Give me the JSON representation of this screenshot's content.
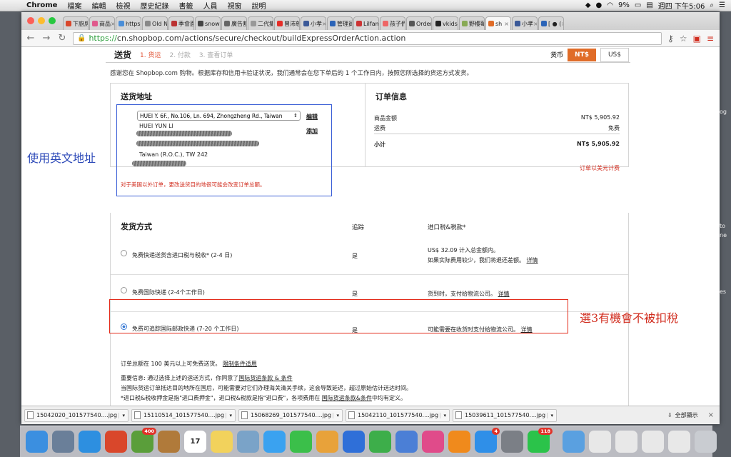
{
  "menubar": {
    "app": "Chrome",
    "items": [
      "檔案",
      "編輯",
      "檢視",
      "歷史紀錄",
      "書籤",
      "人員",
      "視窗",
      "說明"
    ],
    "battery": "9%",
    "clock": "週四 下午5:06"
  },
  "tabs": [
    {
      "title": "下廚房",
      "color": "#d9472b"
    },
    {
      "title": "商品",
      "color": "#e05a8c"
    },
    {
      "title": "https",
      "color": "#4a8ed8"
    },
    {
      "title": "Old N",
      "color": "#888"
    },
    {
      "title": "季會面",
      "color": "#b33"
    },
    {
      "title": "snow",
      "color": "#444"
    },
    {
      "title": "廣告割",
      "color": "#666"
    },
    {
      "title": "二代集",
      "color": "#999"
    },
    {
      "title": "曾沛慈",
      "color": "#e52d27"
    },
    {
      "title": "小孝",
      "color": "#3b5998"
    },
    {
      "title": "管理員",
      "color": "#2b64b8"
    },
    {
      "title": "Lilfam",
      "color": "#c33"
    },
    {
      "title": "孩子們",
      "color": "#e66"
    },
    {
      "title": "Order",
      "color": "#555"
    },
    {
      "title": "vkids",
      "color": "#222"
    },
    {
      "title": "野櫻莓",
      "color": "#8a5"
    },
    {
      "title": "sh",
      "color": "#e06c28",
      "active": true
    },
    {
      "title": "小孝",
      "color": "#3b5998"
    },
    {
      "title": "[ ● (",
      "color": "#2b64b8"
    }
  ],
  "url": {
    "scheme": "https://",
    "rest": "cn.shopbop.com/actions/secure/checkout/buildExpressOrderAction.action"
  },
  "checkout": {
    "title": "送货",
    "steps": [
      "1. 货运",
      "2. 付款",
      "3. 查看订单"
    ],
    "currency_label": "货币",
    "currency_selected": "NT$",
    "currency_other": "US$",
    "intro": "感谢您在 Shopbop.com 购物。根据库存和信用卡验证状况，我们通常会在您下单后的 1 个工作日内，按照您所选择的货运方式发货。",
    "address": {
      "heading": "送货地址",
      "selected": "HUEI Y. 6F., No.106, Ln. 694, Zhongzheng Rd., Taiwan",
      "edit": "编辑",
      "add": "添加",
      "name": "HUEI YUN LI",
      "country_line": "Taiwan (R.O.C.), TW 242",
      "note": "对于美国以外订单，更改送货目的地很可能会改变订单总额。"
    },
    "order": {
      "heading": "订单信息",
      "rows": [
        {
          "label": "商品金额",
          "value": "NT$ 5,905.92"
        },
        {
          "label": "运费",
          "value": "免费"
        }
      ],
      "subtotal_label": "小计",
      "subtotal_value": "NT$ 5,905.92",
      "usd_note": "订单以美元计费"
    },
    "shipping": {
      "heading": "发货方式",
      "col_track": "追踪",
      "col_duty": "进口税&税款*",
      "options": [
        {
          "label": "免费快递送货含进口税与税收* (2-4 日)",
          "track": "是",
          "duty": "US$ 32.09 计入总金额内。",
          "duty2": "如果实际费用较少，我们将退还差额。",
          "link": "详情"
        },
        {
          "label": "免费国际快递 (2-4个工作日)",
          "track": "是",
          "duty": "货到时，支付给物流公司。",
          "link": "详情"
        },
        {
          "label": "免费可追踪国际邮政快递 (7-20 个工作日)",
          "track": "是",
          "duty": "可能需要在收货时支付给物流公司。",
          "link": "详情"
        }
      ]
    },
    "footer": {
      "free_text": "订单总额在 100 美元以上可免费送货。",
      "free_link": "限制条件适用",
      "important": "重要信息: 通过选择上述的运送方式，你同意了",
      "important_link": "国际货运条款 & 条件",
      "line2": "当国际货运订单抵达目的地所在国后，可能需要对它们办理海关清关手续，这会导致延迟，超过原始估计送达时间。",
      "line3_a": "*进口税&税收押金是指\"进口费押金\"，进口税&税款是指\"进口费\"，各项费用在",
      "line3_link": "国际货运条款&条件",
      "line3_b": "中均有定义。"
    }
  },
  "annotations": {
    "address": "使用英文地址",
    "shipping": "選3有機會不被扣稅"
  },
  "downloads": [
    "15042020_101577540....jpg",
    "15110514_101577540....jpg",
    "15068269_101577540....jpg",
    "15042110_101577540....jpg",
    "15039611_101577540....jpg"
  ],
  "downloads_showall": "全部顯示",
  "bg_fragments": [
    "og",
    "to",
    "ne",
    "es"
  ],
  "dock": [
    {
      "name": "finder",
      "c": "#3b8fe0"
    },
    {
      "name": "launchpad",
      "c": "#6a7f99"
    },
    {
      "name": "safari",
      "c": "#2d8fe0"
    },
    {
      "name": "chrome",
      "c": "#d9472b"
    },
    {
      "name": "photos-app",
      "c": "#5a9e3a",
      "badge": "400"
    },
    {
      "name": "contacts",
      "c": "#b07a3a"
    },
    {
      "name": "calendar",
      "c": "#ffffff",
      "label": "17"
    },
    {
      "name": "notes",
      "c": "#f2d25c"
    },
    {
      "name": "preview",
      "c": "#7aa3c8"
    },
    {
      "name": "messages",
      "c": "#3aa2f0"
    },
    {
      "name": "facetime",
      "c": "#3bbf4a"
    },
    {
      "name": "photos",
      "c": "#e8a23a"
    },
    {
      "name": "keynote",
      "c": "#2f6fd8"
    },
    {
      "name": "numbers",
      "c": "#3dae4a"
    },
    {
      "name": "keynote-2",
      "c": "#4b7fd6"
    },
    {
      "name": "itunes",
      "c": "#e04b8a"
    },
    {
      "name": "ibooks",
      "c": "#f08a1c"
    },
    {
      "name": "app-store",
      "c": "#2f8fe8",
      "badge": "4"
    },
    {
      "name": "system-preferences",
      "c": "#7b7f86"
    },
    {
      "name": "line",
      "c": "#2bc34a",
      "badge": "118"
    }
  ],
  "dock_right": [
    {
      "name": "downloads-folder",
      "c": "#5aa0e0"
    },
    {
      "name": "doc-1",
      "c": "#e8e8e8"
    },
    {
      "name": "doc-2",
      "c": "#e8e8e8"
    },
    {
      "name": "doc-3",
      "c": "#e8e8e8"
    },
    {
      "name": "doc-4",
      "c": "#e8e8e8"
    },
    {
      "name": "trash",
      "c": "#c9ccd1"
    }
  ]
}
